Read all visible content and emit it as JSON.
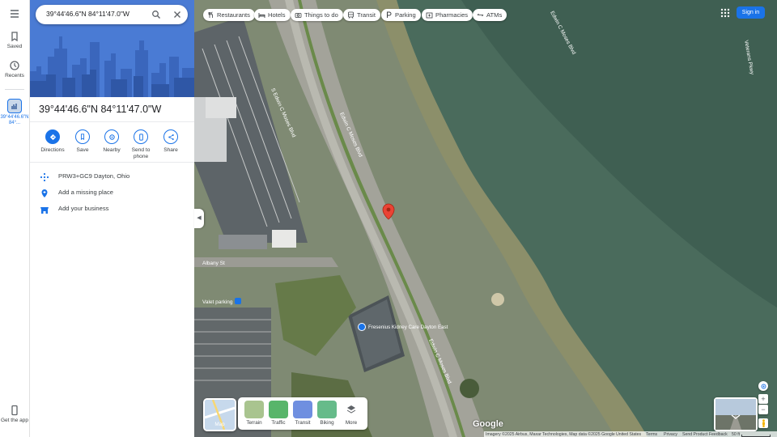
{
  "search": {
    "value": "39°44'46.6\"N 84°11'47.0\"W"
  },
  "rail": {
    "saved": "Saved",
    "recents": "Recents",
    "recent_item": "39°44'46.6\"N 84°...",
    "get_app": "Get the app"
  },
  "panel": {
    "title": "39°44'46.6\"N 84°11'47.0\"W",
    "actions": [
      {
        "label": "Directions",
        "icon": "directions-icon"
      },
      {
        "label": "Save",
        "icon": "bookmark-icon"
      },
      {
        "label": "Nearby",
        "icon": "nearby-icon"
      },
      {
        "label": "Send to phone",
        "icon": "phone-icon"
      },
      {
        "label": "Share",
        "icon": "share-icon"
      }
    ],
    "rows": [
      {
        "text": "PRW3+GC9 Dayton, Ohio",
        "icon": "plus-code-icon"
      },
      {
        "text": "Add a missing place",
        "icon": "add-place-icon"
      },
      {
        "text": "Add your business",
        "icon": "business-icon"
      }
    ]
  },
  "chips": [
    {
      "label": "Restaurants",
      "icon": "restaurant-icon"
    },
    {
      "label": "Hotels",
      "icon": "hotel-icon"
    },
    {
      "label": "Things to do",
      "icon": "camera-icon"
    },
    {
      "label": "Transit",
      "icon": "transit-icon"
    },
    {
      "label": "Parking",
      "icon": "parking-icon"
    },
    {
      "label": "Pharmacies",
      "icon": "pharmacy-icon"
    },
    {
      "label": "ATMs",
      "icon": "atm-icon"
    }
  ],
  "signin": "Sign in",
  "map_labels": {
    "street_left": "S Edwin C Moses Blvd",
    "street_right": "Edwin C Moses Blvd",
    "albany": "Albany St",
    "parking": "Valet parking",
    "clinic": "Fresenius Kidney Care Dayton East",
    "veterans": "Veterans Pkwy"
  },
  "layers": {
    "map": "Map",
    "items": [
      {
        "label": "Terrain",
        "color": "#a9c48f"
      },
      {
        "label": "Traffic",
        "color": "#58b56a"
      },
      {
        "label": "Transit",
        "color": "#6f8fe0"
      },
      {
        "label": "Biking",
        "color": "#66bb8a"
      },
      {
        "label": "More",
        "color": "#ffffff"
      }
    ]
  },
  "footer": {
    "imagery": "Imagery ©2025 Airbus, Maxar Technologies, Map data ©2025 Google",
    "country": "United States",
    "terms": "Terms",
    "privacy": "Privacy",
    "feedback": "Send Product Feedback",
    "scale": "50 ft"
  },
  "google_logo": "Google",
  "colors": {
    "accent": "#1a73e8",
    "pin": "#ea4335"
  }
}
